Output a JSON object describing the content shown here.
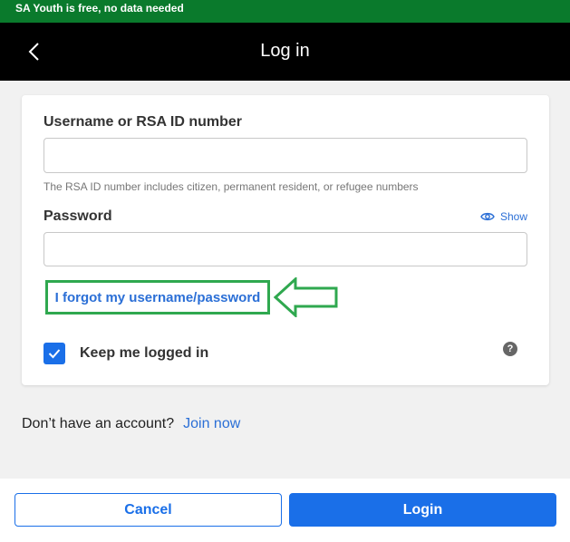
{
  "banner": {
    "text": "SA Youth is free, no data needed"
  },
  "header": {
    "title": "Log in",
    "back_icon": "chevron-left-icon"
  },
  "form": {
    "username_label": "Username or RSA ID number",
    "username_value": "",
    "username_hint": "The RSA ID number includes citizen, permanent resident, or refugee numbers",
    "password_label": "Password",
    "password_value": "",
    "show_label": "Show",
    "forgot_link": "I forgot my username/password",
    "keep_logged_in_label": "Keep me logged in",
    "keep_logged_in_checked": true,
    "help_icon": "?"
  },
  "signup": {
    "prompt": "Don’t have an account?",
    "link": "Join now"
  },
  "footer": {
    "cancel_label": "Cancel",
    "login_label": "Login"
  },
  "colors": {
    "banner": "#0a7a2c",
    "header": "#000000",
    "accent": "#1a6fe8",
    "link": "#2b6fd6",
    "annotation": "#2fa84f"
  }
}
